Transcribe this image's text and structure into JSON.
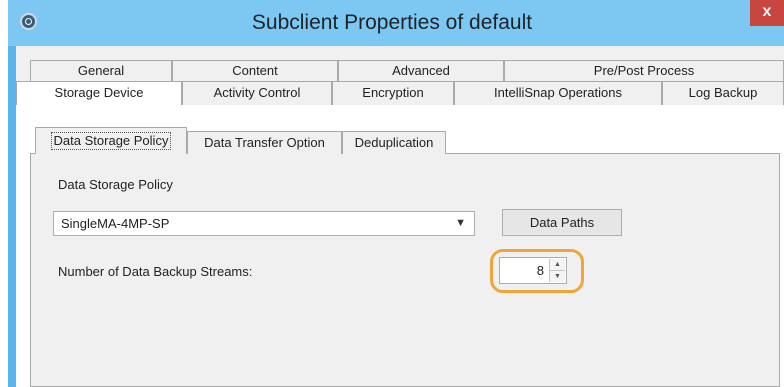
{
  "window": {
    "title": "Subclient Properties of default",
    "close_label": "x"
  },
  "tabs_row1": [
    "General",
    "Content",
    "Advanced",
    "Pre/Post Process"
  ],
  "tabs_row2": [
    "Storage Device",
    "Activity Control",
    "Encryption",
    "IntelliSnap Operations",
    "Log Backup"
  ],
  "selected_tab": "Storage Device",
  "subtabs": [
    "Data Storage Policy",
    "Data Transfer Option",
    "Deduplication"
  ],
  "selected_subtab": "Data Storage Policy",
  "storage_policy": {
    "label": "Data Storage Policy",
    "value": "SingleMA-4MP-SP",
    "data_paths_button": "Data Paths"
  },
  "streams": {
    "label": "Number of Data Backup Streams:",
    "value": "8"
  },
  "colors": {
    "title_bar": "#7cc8f3",
    "close_button": "#c7463d",
    "highlight": "#f2a33a"
  }
}
